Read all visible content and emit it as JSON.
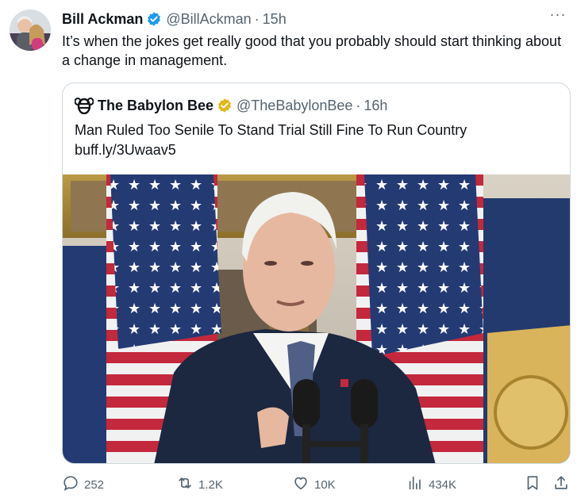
{
  "tweet": {
    "author_name": "Bill Ackman",
    "author_handle": "@BillAckman",
    "separator": "·",
    "time": "15h",
    "more_label": "···",
    "text": "It’s when the jokes get really good that you probably should start thinking about a change in management."
  },
  "quote": {
    "author_name": "The Babylon Bee",
    "author_handle": "@TheBabylonBee",
    "separator": "·",
    "time": "16h",
    "headline": "Man Ruled Too Senile To Stand Trial Still Fine To Run Country",
    "link": "buff.ly/3Uwaav5"
  },
  "actions": {
    "replies": "252",
    "reposts": "1.2K",
    "likes": "10K",
    "views": "434K"
  },
  "colors": {
    "verified_blue": "#1d9bf0",
    "verified_gold": "#e2b719",
    "secondary_text": "#536471",
    "border": "#cfd9de"
  },
  "icons": [
    "verified-badge-icon",
    "more-icon",
    "babylon-bee-logo-icon",
    "gold-badge-icon",
    "reply-icon",
    "repost-icon",
    "like-icon",
    "views-icon",
    "bookmark-icon",
    "share-icon"
  ]
}
